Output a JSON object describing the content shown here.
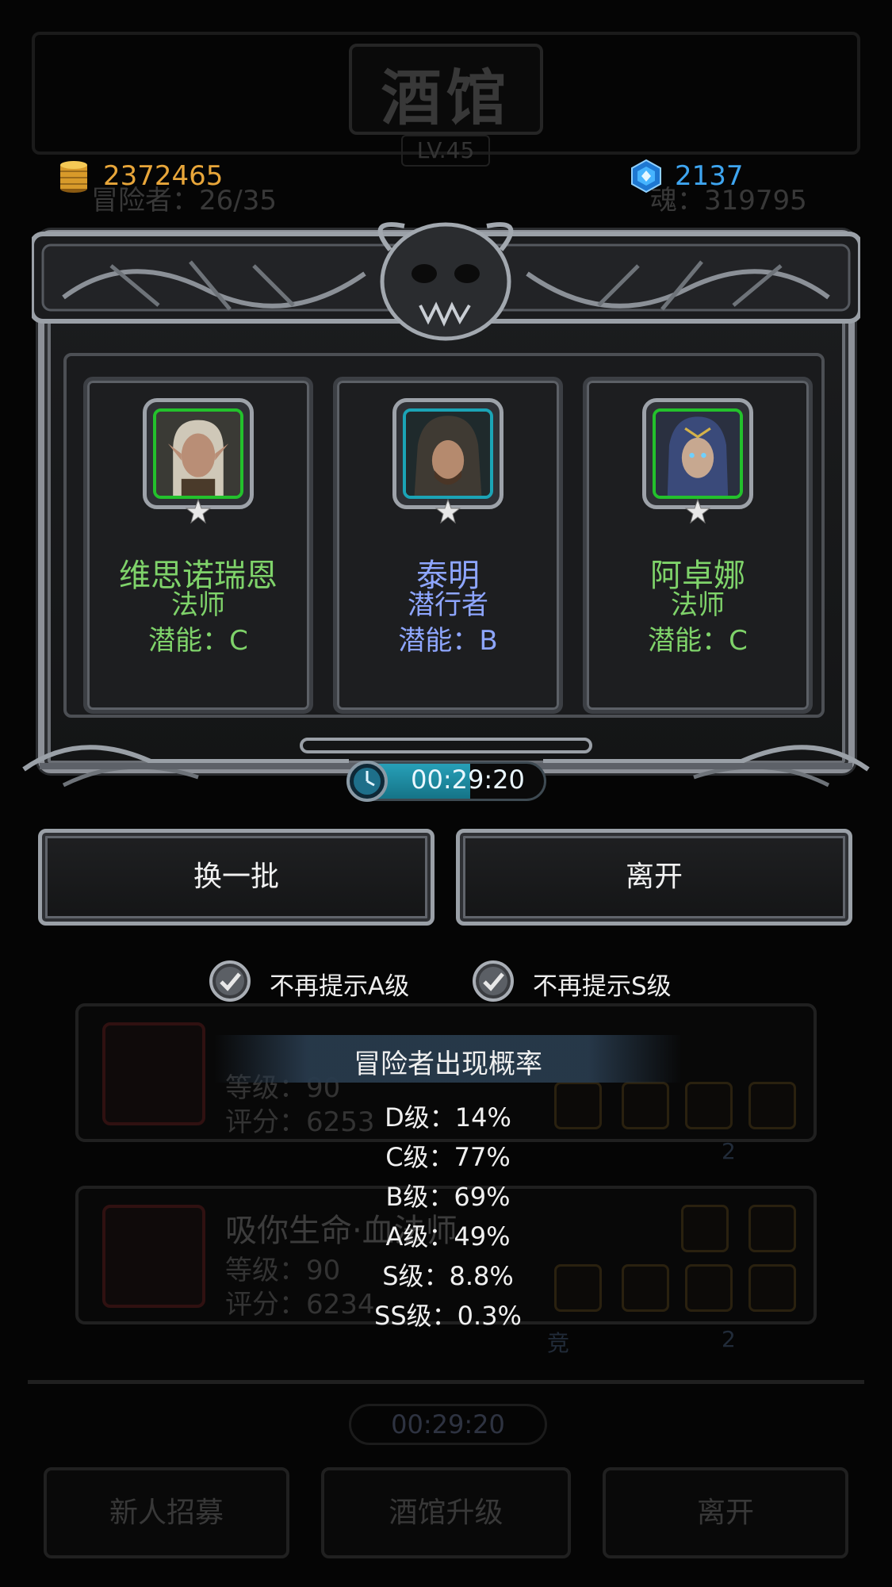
{
  "background": {
    "title": "酒馆",
    "level": "LV.45",
    "adventurer_count": "冒险者：26/35",
    "soul": "魂：319795",
    "cards": [
      {
        "name": "",
        "level": "等级：90",
        "score": "评分：6253"
      },
      {
        "name": "吸你生命·血法师",
        "level": "等级：90",
        "score": "评分：6234"
      }
    ],
    "badges": [
      "2",
      "竞",
      "2"
    ],
    "timer": "00:29:20",
    "buttons": [
      "新人招募",
      "酒馆升级",
      "离开"
    ]
  },
  "resources": {
    "gold": "2372465",
    "gems": "2137"
  },
  "heroes": [
    {
      "name": "维思诺瑞恩",
      "class": "法师",
      "potential": "潜能：C",
      "color": "#7fd36a",
      "frame": "green"
    },
    {
      "name": "泰明",
      "class": "潜行者",
      "potential": "潜能：B",
      "color": "#8ea6ff",
      "frame": "teal"
    },
    {
      "name": "阿卓娜",
      "class": "法师",
      "potential": "潜能：C",
      "color": "#7fd36a",
      "frame": "green"
    }
  ],
  "timer": {
    "text": "00:29:20",
    "fill_fraction": 0.62
  },
  "buttons": {
    "refresh": "换一批",
    "leave": "离开"
  },
  "options": {
    "no_remind_a": "不再提示A级",
    "no_remind_s": "不再提示S级"
  },
  "probability": {
    "title": "冒险者出现概率",
    "rows": [
      "D级：14%",
      "C级：77%",
      "B级：69%",
      "A级：49%",
      "S级：8.8%",
      "SS级：0.3%"
    ]
  }
}
